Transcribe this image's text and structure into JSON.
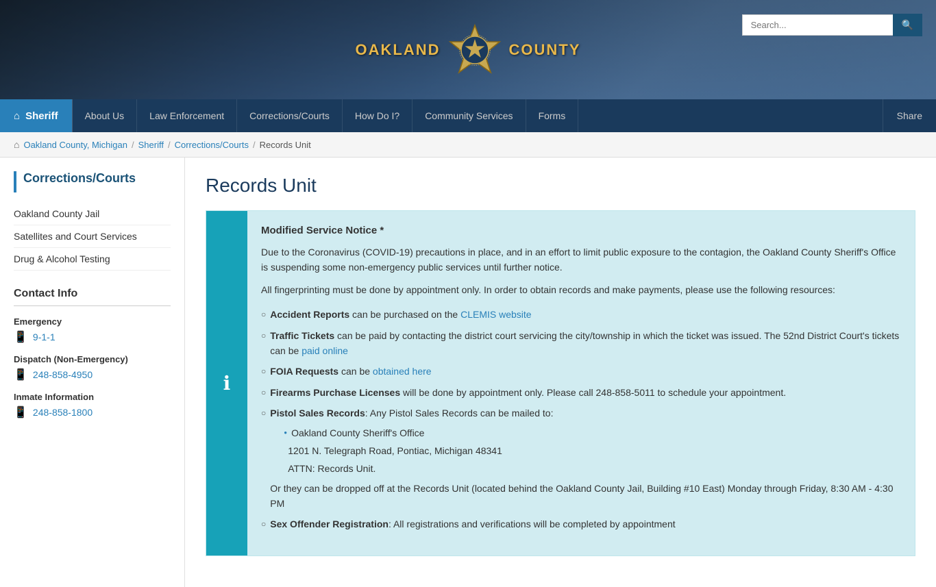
{
  "header": {
    "logo_left": "OAKLAND",
    "logo_right": "COUNTY",
    "search_placeholder": "Search..."
  },
  "nav": {
    "home_label": "Sheriff",
    "items": [
      {
        "label": "About Us"
      },
      {
        "label": "Law Enforcement"
      },
      {
        "label": "Corrections/Courts"
      },
      {
        "label": "How Do I?"
      },
      {
        "label": "Community Services"
      },
      {
        "label": "Forms"
      }
    ],
    "share_label": "Share"
  },
  "breadcrumb": {
    "items": [
      {
        "label": "Oakland County, Michigan",
        "link": true
      },
      {
        "label": "Sheriff",
        "link": true
      },
      {
        "label": "Corrections/Courts",
        "link": true
      },
      {
        "label": "Records Unit",
        "link": false
      }
    ]
  },
  "sidebar": {
    "title": "Corrections/Courts",
    "nav_items": [
      {
        "label": "Oakland County Jail"
      },
      {
        "label": "Satellites and Court Services"
      },
      {
        "label": "Drug & Alcohol Testing"
      }
    ],
    "contact": {
      "title": "Contact Info",
      "sections": [
        {
          "label": "Emergency",
          "phone": "9-1-1"
        },
        {
          "label": "Dispatch (Non-Emergency)",
          "phone": "248-858-4950"
        },
        {
          "label": "Inmate Information",
          "phone": "248-858-1800"
        }
      ]
    }
  },
  "page": {
    "title": "Records Unit",
    "notice": {
      "title": "Modified Service Notice *",
      "intro1": "Due to the Coronavirus (COVID-19) precautions in place, and in an effort to limit public exposure to the contagion, the Oakland County Sheriff's Office is suspending some non-emergency public services until further notice.",
      "intro2": "All fingerprinting must be done by appointment only. In order to obtain records and make payments, please use the following resources:",
      "items": [
        {
          "bold": "Accident Reports",
          "text": " can be purchased on the ",
          "link_text": "CLEMIS website",
          "link_after": ""
        },
        {
          "bold": "Traffic Tickets",
          "text": " can be paid by contacting the district court servicing the city/township in which the ticket was issued. The 52nd District Court's tickets can be ",
          "link_text": "paid online",
          "link_after": ""
        },
        {
          "bold": "FOIA Requests",
          "text": " can be ",
          "link_text": "obtained here",
          "link_after": ""
        },
        {
          "bold": "Firearms Purchase Licenses",
          "text": " will be done by appointment only. Please call 248-858-5011 to schedule your appointment.",
          "link_text": "",
          "link_after": ""
        },
        {
          "bold": "Pistol Sales Records",
          "text": ": Any Pistol Sales Records can be mailed to:",
          "sub_items": [
            "Oakland County Sheriff's Office",
            "1201 N. Telegraph Road, Pontiac, Michigan 48341",
            "ATTN: Records Unit."
          ],
          "extra_text": "Or they can be dropped off at the Records Unit (located behind the Oakland County Jail, Building #10 East) Monday through Friday, 8:30 AM - 4:30 PM"
        },
        {
          "bold": "Sex Offender Registration",
          "text": ":  All registrations and verifications will be completed by appointment"
        }
      ]
    }
  }
}
